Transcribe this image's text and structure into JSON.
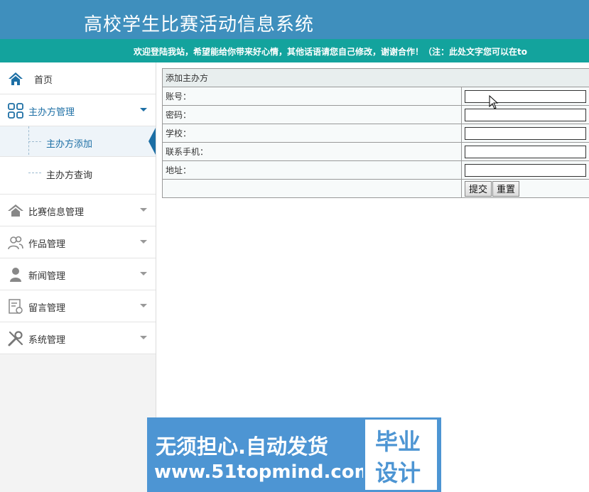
{
  "header": {
    "title": "高校学生比赛活动信息系统"
  },
  "marquee": {
    "text": "欢迎登陆我站，希望能给你带来好心情，其他话语请您自己修改，谢谢合作！（注：此处文字您可以在to"
  },
  "colors": {
    "header_bg": "#3f8fbd",
    "marquee_bg": "#13a39d",
    "accent": "#1d6fa5"
  },
  "sidebar": {
    "home": {
      "label": "首页",
      "icon": "home-icon"
    },
    "groups": [
      {
        "label": "主办方管理",
        "icon": "grid-icon",
        "expanded": true,
        "children": [
          {
            "label": "主办方添加",
            "current": true
          },
          {
            "label": "主办方查询"
          }
        ]
      },
      {
        "label": "比赛信息管理",
        "icon": "house-icon"
      },
      {
        "label": "作品管理",
        "icon": "users-icon"
      },
      {
        "label": "新闻管理",
        "icon": "person-icon"
      },
      {
        "label": "留言管理",
        "icon": "note-icon"
      },
      {
        "label": "系统管理",
        "icon": "tools-icon"
      }
    ]
  },
  "form": {
    "caption": "添加主办方",
    "fields": [
      {
        "label": "账号：",
        "value": ""
      },
      {
        "label": "密码：",
        "value": ""
      },
      {
        "label": "学校：",
        "value": ""
      },
      {
        "label": "联系手机：",
        "value": ""
      },
      {
        "label": "地址：",
        "value": ""
      }
    ],
    "submit_label": "提交",
    "reset_label": "重置"
  },
  "watermark": {
    "line1": "无须担心.自动发货",
    "line2": "www.51topmind.com",
    "box_line1": "毕业",
    "box_line2": "设计"
  }
}
